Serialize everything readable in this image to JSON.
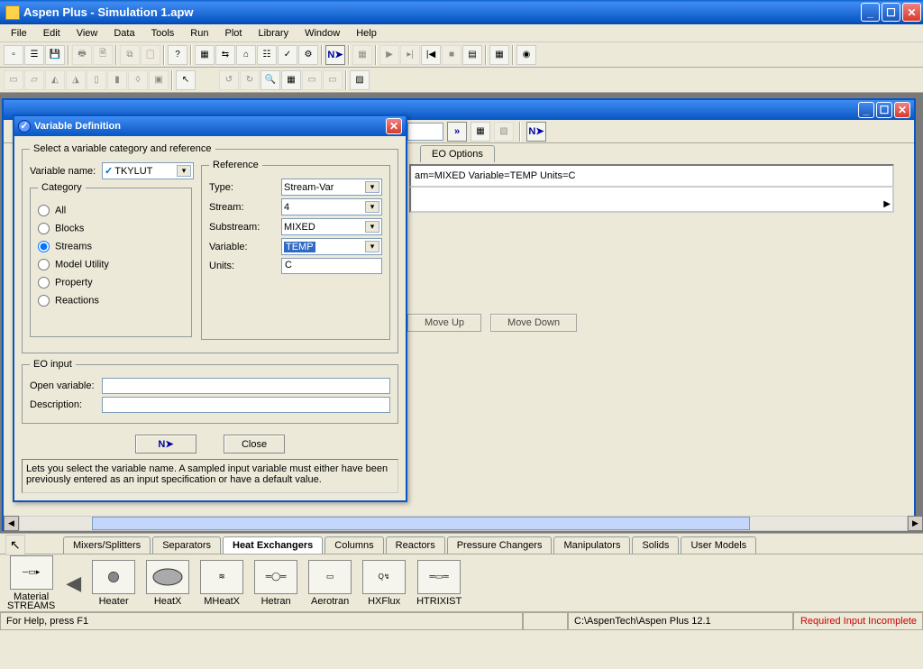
{
  "window": {
    "title": "Aspen Plus - Simulation 1.apw"
  },
  "menu": [
    "File",
    "Edit",
    "View",
    "Data",
    "Tools",
    "Run",
    "Plot",
    "Library",
    "Window",
    "Help"
  ],
  "toolbar_next": "N➤",
  "child": {
    "tab_eo": "EO Options",
    "varsummary": "am=MIXED Variable=TEMP Units=C",
    "moveup": "Move Up",
    "movedown": "Move Down"
  },
  "dlg": {
    "title": "Variable Definition",
    "fs1": "Select a variable category and reference",
    "varname_lbl": "Variable name:",
    "varname_val": "TKYLUT",
    "category_lbl": "Category",
    "cat": {
      "all": "All",
      "blocks": "Blocks",
      "streams": "Streams",
      "mu": "Model Utility",
      "prop": "Property",
      "react": "Reactions"
    },
    "ref_lbl": "Reference",
    "type_lbl": "Type:",
    "type_val": "Stream-Var",
    "stream_lbl": "Stream:",
    "stream_val": "4",
    "substream_lbl": "Substream:",
    "substream_val": "MIXED",
    "variable_lbl": "Variable:",
    "variable_val": "TEMP",
    "units_lbl": "Units:",
    "units_val": "C",
    "eo_lbl": "EO input",
    "open_lbl": "Open variable:",
    "desc_lbl": "Description:",
    "btn_next": "N➤",
    "btn_close": "Close",
    "help": "Lets you select the variable name. A sampled input variable must either have been previously entered as an input specification or have a default value."
  },
  "palette": {
    "tabs": [
      "Mixers/Splitters",
      "Separators",
      "Heat Exchangers",
      "Columns",
      "Reactors",
      "Pressure Changers",
      "Manipulators",
      "Solids",
      "User Models"
    ],
    "left1": "Material",
    "left2": "STREAMS",
    "items": [
      "Heater",
      "HeatX",
      "MHeatX",
      "Hetran",
      "Aerotran",
      "HXFlux",
      "HTRIXIST"
    ]
  },
  "status": {
    "help": "For Help, press F1",
    "path": "C:\\AspenTech\\Aspen Plus 12.1",
    "req": "Required Input Incomplete"
  }
}
